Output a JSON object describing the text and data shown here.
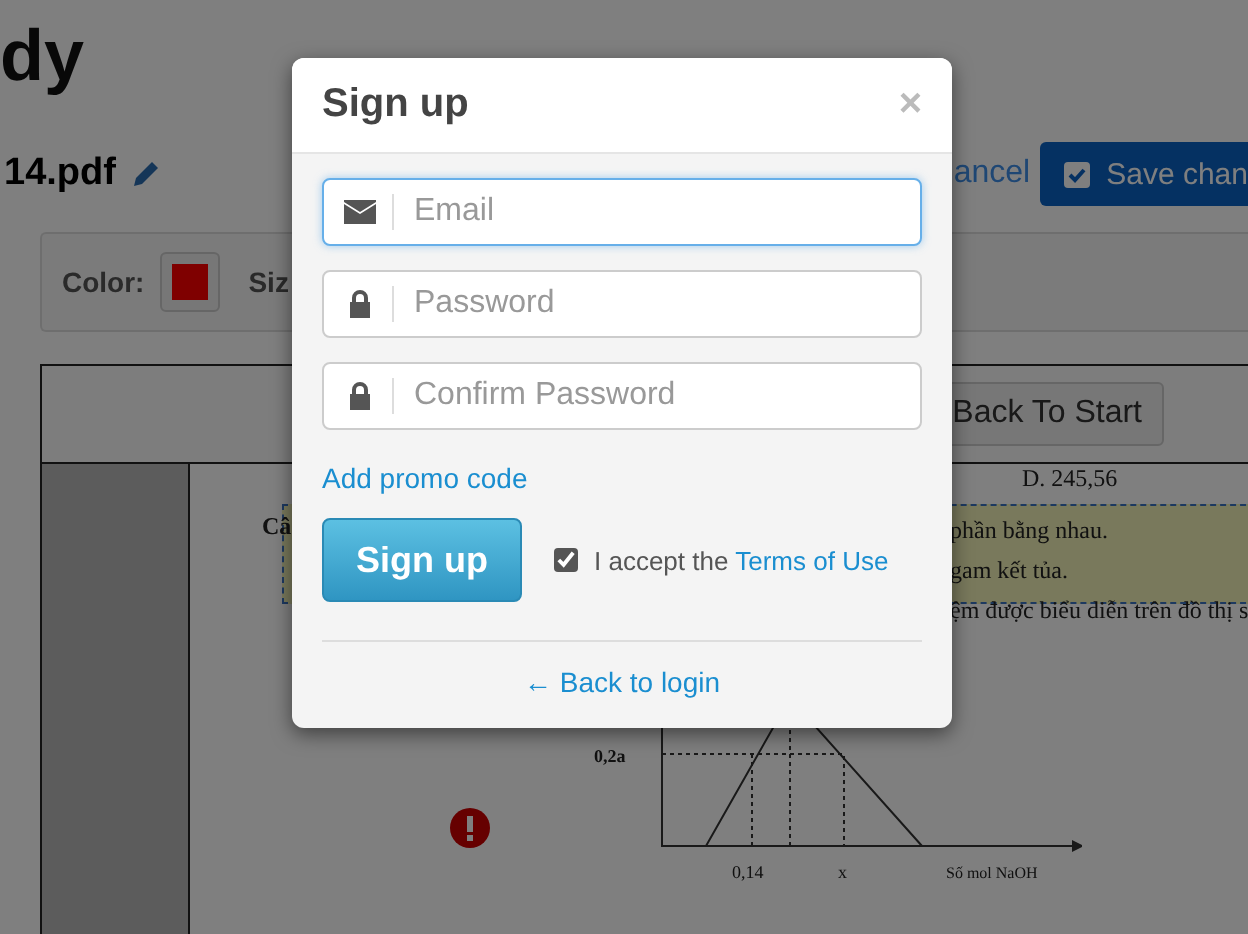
{
  "page": {
    "title": "dy",
    "file_name": "14.pdf",
    "cancel_link": "ancel",
    "save_button": "Save chan"
  },
  "toolbar": {
    "color_label": "Color:",
    "color": "#800000",
    "size_label": "Siz"
  },
  "document": {
    "back_button": "Back To Start",
    "answer": "D. 245,56",
    "line_start": "Câ",
    "lines": [
      "phần bằng nhau.",
      "gam kết tủa.",
      "ệm được biểu diễn trên đồ thị s"
    ],
    "graph_labels": {
      "y_tick": "0,2a",
      "x_tick_1": "0,14",
      "x_tick_2": "x",
      "x_axis": "Số mol NaOH"
    }
  },
  "modal": {
    "title": "Sign up",
    "close": "×",
    "fields": [
      {
        "kind": "email",
        "placeholder": "Email",
        "focused": true
      },
      {
        "kind": "password",
        "placeholder": "Password",
        "focused": false
      },
      {
        "kind": "password",
        "placeholder": "Confirm Password",
        "focused": false
      }
    ],
    "promo_link": "Add promo code",
    "submit": "Sign up",
    "terms": {
      "checked": true,
      "text": "I accept the",
      "link": "Terms of Use"
    },
    "back_link": "← Back to login"
  }
}
